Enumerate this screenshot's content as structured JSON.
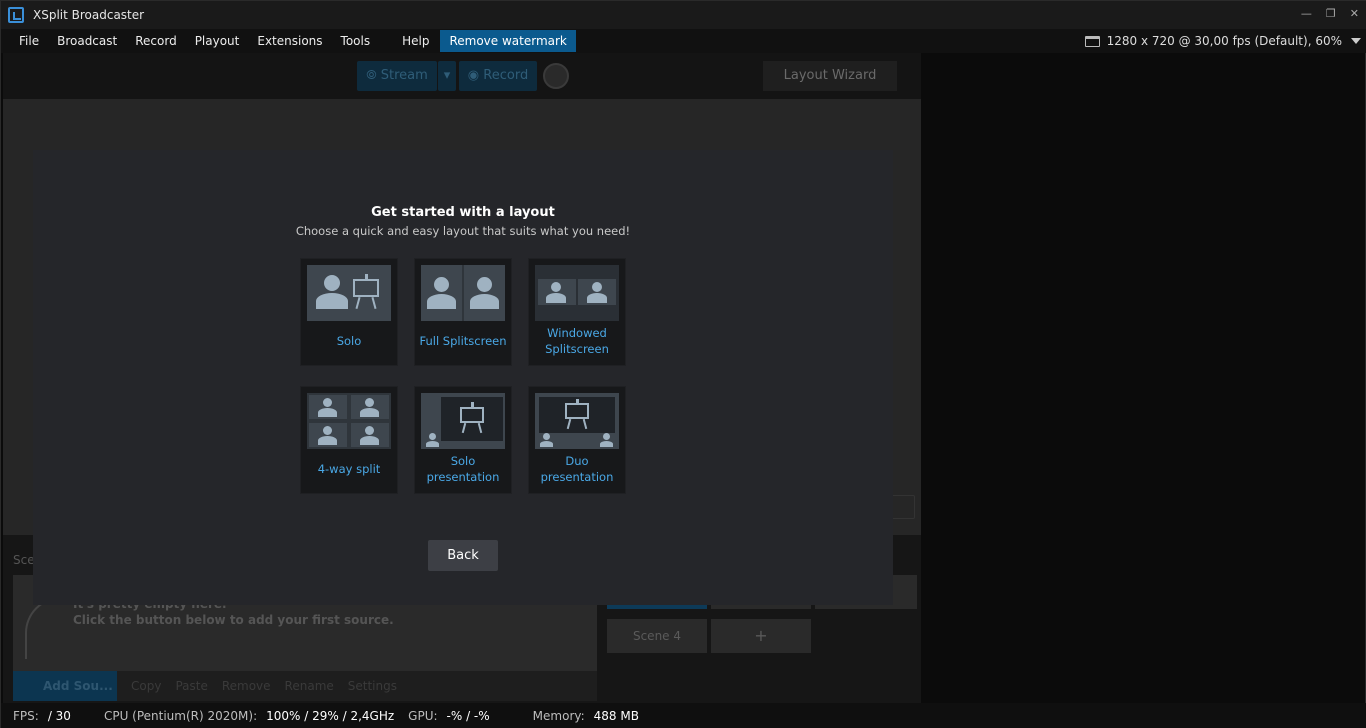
{
  "app": {
    "title": "XSplit Broadcaster"
  },
  "window_controls": {
    "minimize": "—",
    "restore": "❐",
    "close": "✕"
  },
  "menu": {
    "items": [
      "File",
      "Broadcast",
      "Record",
      "Playout",
      "Extensions",
      "Tools"
    ],
    "help": "Help",
    "watermark": "Remove watermark",
    "resolution": "1280 x 720 @ 30,00 fps (Default), 60%"
  },
  "toolbar": {
    "stream": "Stream",
    "record": "Record",
    "layout_wizard": "Layout Wizard"
  },
  "scenes": {
    "label": "Sce",
    "scene4": "Scene 4",
    "add": "+"
  },
  "sources": {
    "empty_line1": "It's pretty empty here.",
    "empty_line2": "Click the button below to add your first source.",
    "add_source": "Add Sou...",
    "actions": [
      "Copy",
      "Paste",
      "Remove",
      "Rename",
      "Settings"
    ]
  },
  "modal": {
    "title": "Get started with a layout",
    "subtitle": "Choose a quick and easy layout that suits what you need!",
    "layouts": [
      {
        "label": "Solo"
      },
      {
        "label": "Full Splitscreen"
      },
      {
        "label": "Windowed Splitscreen"
      },
      {
        "label": "4-way split"
      },
      {
        "label": "Solo presentation"
      },
      {
        "label": "Duo presentation"
      }
    ],
    "back": "Back"
  },
  "status": {
    "fps_label": "FPS:",
    "fps_value": "/ 30",
    "cpu_label": "CPU (Pentium(R) 2020M):",
    "cpu_value": "100% / 29% / 2,4GHz",
    "gpu_label": "GPU:",
    "gpu_value": "-% / -%",
    "mem_label": "Memory:",
    "mem_value": "488 MB"
  }
}
